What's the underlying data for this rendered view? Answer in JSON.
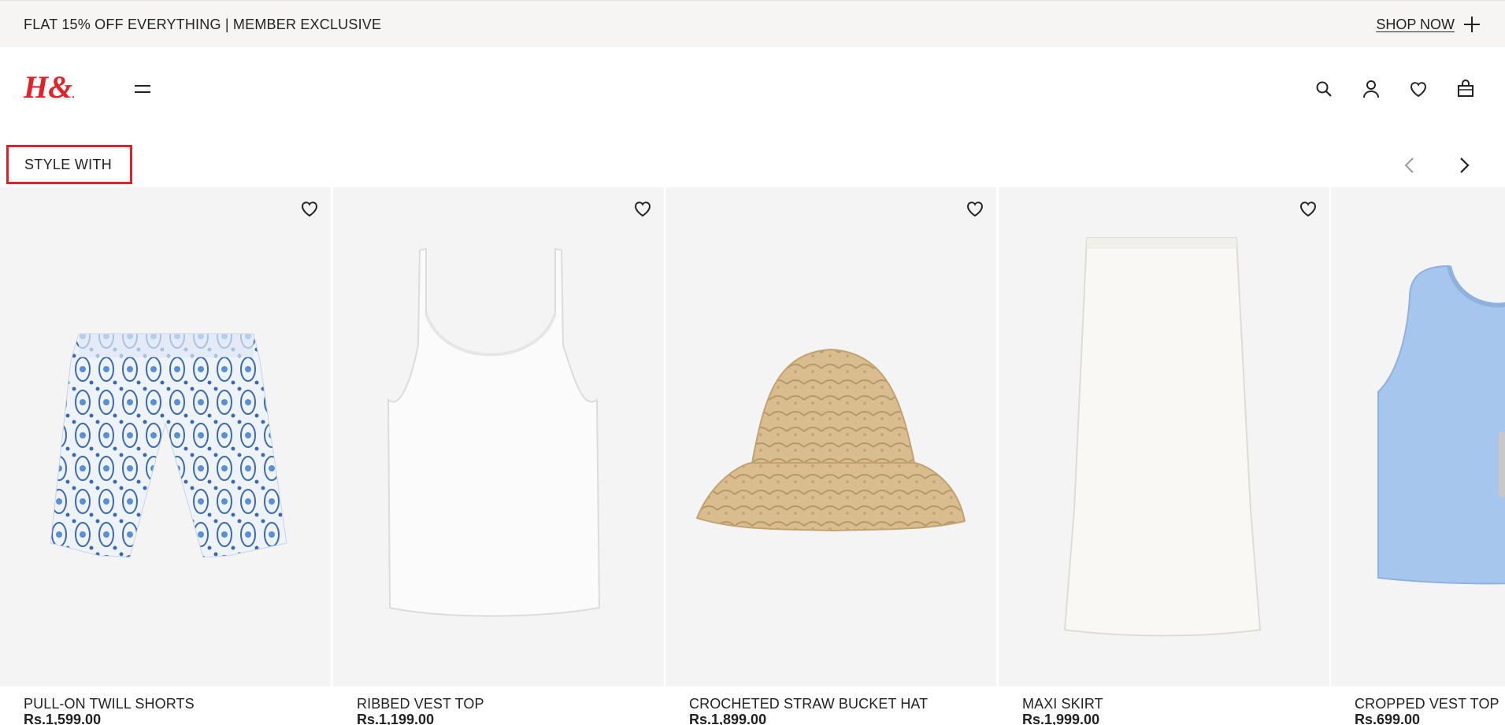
{
  "promo": {
    "text": "FLAT 15% OFF EVERYTHING | MEMBER EXCLUSIVE",
    "cta": "SHOP NOW"
  },
  "header": {
    "logo_text": "H&M",
    "brand_color": "#e1222b",
    "icons": [
      "menu-icon",
      "search-icon",
      "account-icon",
      "favorites-icon",
      "bag-icon"
    ]
  },
  "section": {
    "title": "STYLE WITH"
  },
  "products": [
    {
      "name": "PULL-ON TWILL SHORTS",
      "price": "Rs.1,599.00"
    },
    {
      "name": "RIBBED VEST TOP",
      "price": "Rs.1,199.00"
    },
    {
      "name": "CROCHETED STRAW BUCKET HAT",
      "price": "Rs.1,899.00"
    },
    {
      "name": "MAXI SKIRT",
      "price": "Rs.1,999.00"
    },
    {
      "name": "CROPPED VEST TOP",
      "price": "Rs.699.00"
    }
  ]
}
